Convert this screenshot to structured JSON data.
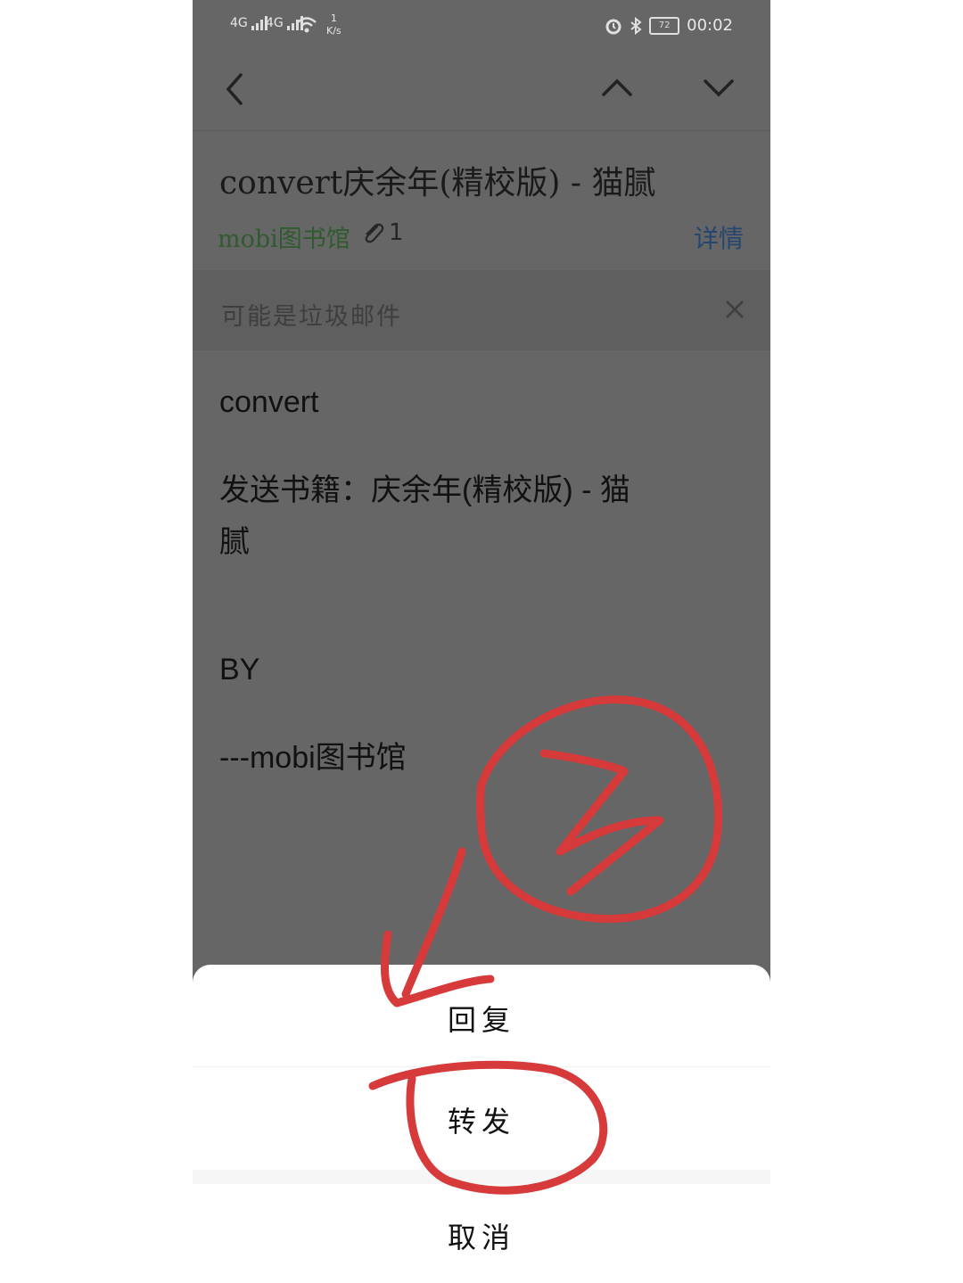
{
  "status_bar": {
    "signal_1": "4G",
    "signal_2": "4G",
    "net_speed": "1",
    "net_speed_unit": "K/s",
    "battery": "72",
    "time": "00:02"
  },
  "email": {
    "subject": "convert庆余年(精校版)  - 猫腻",
    "sender": "mobi图书馆",
    "attachment_count": "1",
    "details_label": "详情"
  },
  "spam_notice": {
    "text": "可能是垃圾邮件"
  },
  "body": {
    "line1": "convert",
    "line2": "发送书籍：庆余年(精校版)  - 猫",
    "line3": "腻",
    "line4": "BY",
    "line5": "---mobi图书馆"
  },
  "action_sheet": {
    "reply": "回复",
    "forward": "转发",
    "cancel": "取消"
  },
  "annotation": {
    "color": "#d63a3a"
  }
}
